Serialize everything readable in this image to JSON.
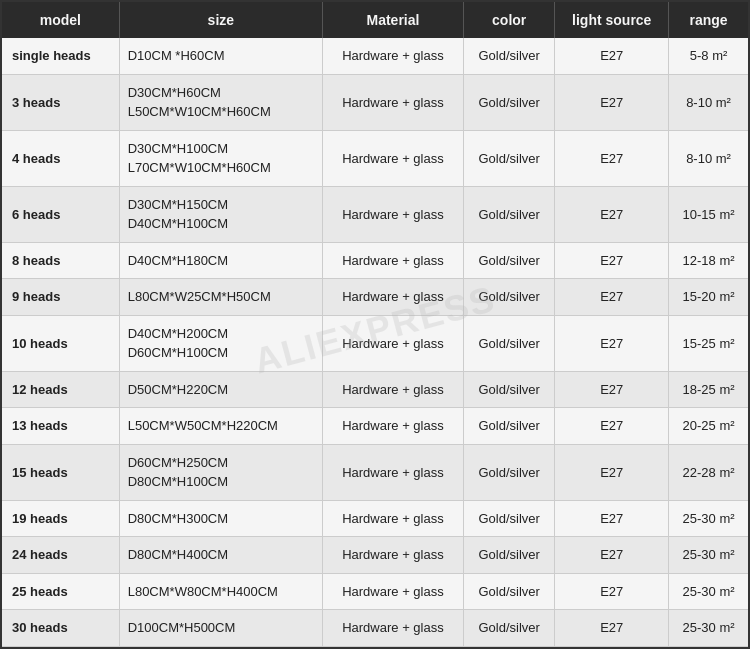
{
  "table": {
    "headers": [
      "model",
      "size",
      "Material",
      "color",
      "light source",
      "range"
    ],
    "rows": [
      {
        "model": "single heads",
        "size": "D10CM *H60CM",
        "material": "Hardware + glass",
        "color": "Gold/silver",
        "lightSource": "E27",
        "range": "5-8 m²"
      },
      {
        "model": "3 heads",
        "size": "D30CM*H60CM\nL50CM*W10CM*H60CM",
        "material": "Hardware + glass",
        "color": "Gold/silver",
        "lightSource": "E27",
        "range": "8-10 m²"
      },
      {
        "model": "4 heads",
        "size": "D30CM*H100CM\nL70CM*W10CM*H60CM",
        "material": "Hardware + glass",
        "color": "Gold/silver",
        "lightSource": "E27",
        "range": "8-10 m²"
      },
      {
        "model": "6 heads",
        "size": "D30CM*H150CM\nD40CM*H100CM",
        "material": "Hardware + glass",
        "color": "Gold/silver",
        "lightSource": "E27",
        "range": "10-15 m²"
      },
      {
        "model": "8 heads",
        "size": "D40CM*H180CM",
        "material": "Hardware + glass",
        "color": "Gold/silver",
        "lightSource": "E27",
        "range": "12-18 m²"
      },
      {
        "model": "9 heads",
        "size": "L80CM*W25CM*H50CM",
        "material": "Hardware + glass",
        "color": "Gold/silver",
        "lightSource": "E27",
        "range": "15-20 m²"
      },
      {
        "model": "10 heads",
        "size": "D40CM*H200CM\nD60CM*H100CM",
        "material": "Hardware + glass",
        "color": "Gold/silver",
        "lightSource": "E27",
        "range": "15-25 m²"
      },
      {
        "model": "12 heads",
        "size": "D50CM*H220CM",
        "material": "Hardware + glass",
        "color": "Gold/silver",
        "lightSource": "E27",
        "range": "18-25 m²"
      },
      {
        "model": "13 heads",
        "size": "L50CM*W50CM*H220CM",
        "material": "Hardware + glass",
        "color": "Gold/silver",
        "lightSource": "E27",
        "range": "20-25 m²"
      },
      {
        "model": "15 heads",
        "size": "D60CM*H250CM\nD80CM*H100CM",
        "material": "Hardware + glass",
        "color": "Gold/silver",
        "lightSource": "E27",
        "range": "22-28 m²"
      },
      {
        "model": "19 heads",
        "size": "D80CM*H300CM",
        "material": "Hardware + glass",
        "color": "Gold/silver",
        "lightSource": "E27",
        "range": "25-30 m²"
      },
      {
        "model": "24 heads",
        "size": "D80CM*H400CM",
        "material": "Hardware + glass",
        "color": "Gold/silver",
        "lightSource": "E27",
        "range": "25-30 m²"
      },
      {
        "model": "25 heads",
        "size": "L80CM*W80CM*H400CM",
        "material": "Hardware + glass",
        "color": "Gold/silver",
        "lightSource": "E27",
        "range": "25-30 m²"
      },
      {
        "model": "30 heads",
        "size": "D100CM*H500CM",
        "material": "Hardware + glass",
        "color": "Gold/silver",
        "lightSource": "E27",
        "range": "25-30 m²"
      }
    ]
  }
}
